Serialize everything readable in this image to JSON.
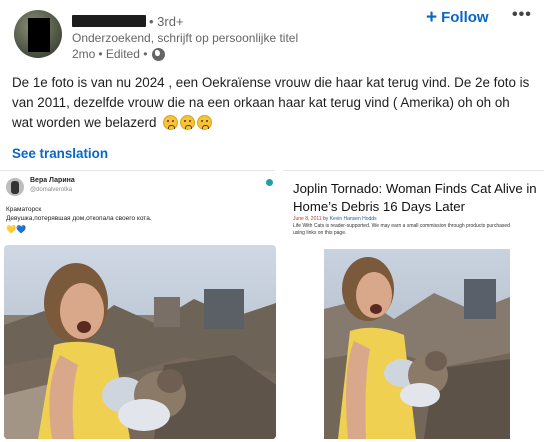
{
  "post": {
    "degree": "• 3rd+",
    "headline": "Onderzoekend, schrijft op persoonlijke titel",
    "time": "2mo",
    "edited": "• Edited •",
    "follow_label": "Follow",
    "more_label": "•••",
    "text": "De 1e foto is van nu 2024 , een Oekraïense vrouw die haar kat terug vind. De 2e foto is van 2011, dezelfde vrouw die na een orkaan haar kat terug vind ( Amerika) oh oh oh wat worden we belazerd",
    "see_translation": "See translation"
  },
  "left_image": {
    "name": "Вера Ларина",
    "handle": "@domalverotka",
    "line1": "Краматорск",
    "line2": "Девушка,потерявшая дом,откопала своего кота.",
    "hearts": [
      "💛",
      "💙"
    ]
  },
  "right_image": {
    "title": "Joplin Tornado: Woman Finds Cat Alive in Home’s Debris 16 Days Later",
    "date": "June 8, 2011",
    "by": "by",
    "author": "Kevin Hansen Hodds",
    "disclaimer": "Life With Cats is reader-supported. We may earn a small commission through products purchased using links on this page."
  },
  "colors": {
    "link_blue": "#0a66c2",
    "text": "#1f1f1f",
    "muted": "#666666"
  },
  "icons": {
    "globe": "globe-icon",
    "plus": "plus-icon",
    "more": "more-icon",
    "emoji": "sad-face-emoji"
  }
}
